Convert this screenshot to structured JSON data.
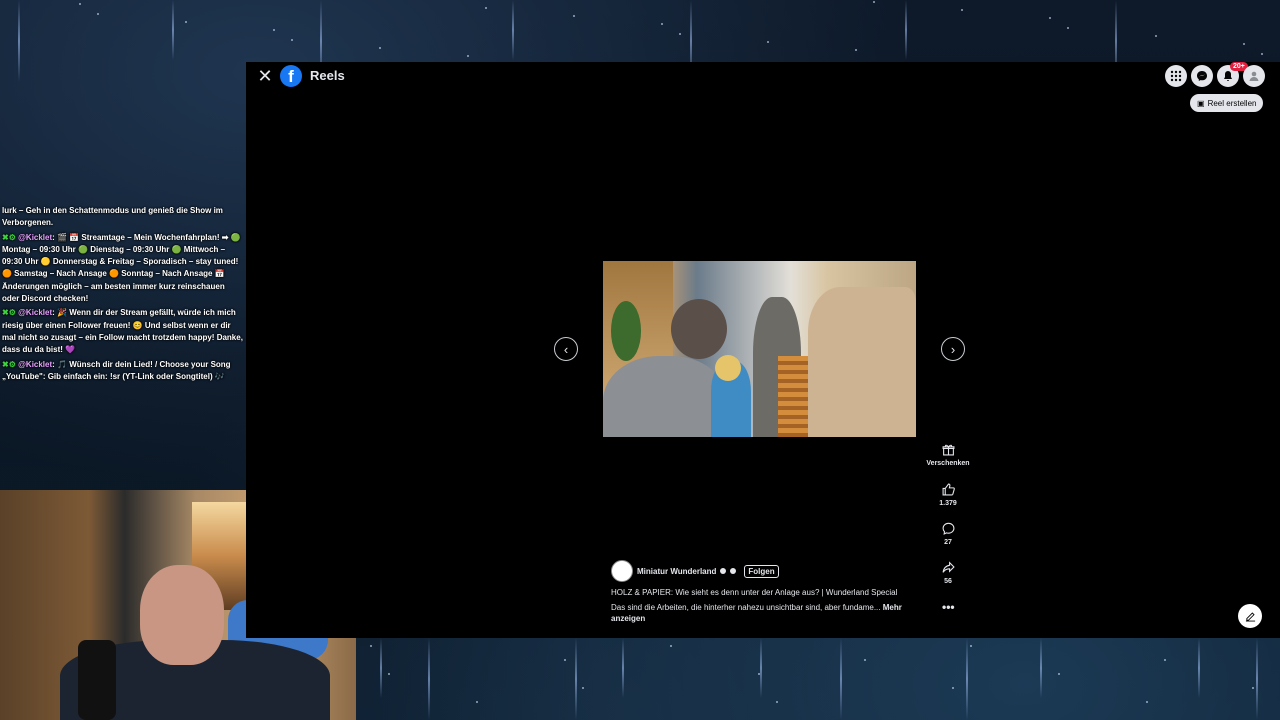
{
  "facebook": {
    "close_icon": "close-icon",
    "logo_letter": "f",
    "page_title": "Reels",
    "top_icons": [
      "menu-grid-icon",
      "messenger-icon",
      "notifications-icon",
      "profile-icon"
    ],
    "notification_badge": "20+",
    "create_reel_label": "Reel erstellen",
    "reel": {
      "prev_icon": "chevron-left-icon",
      "next_icon": "chevron-right-icon",
      "actions": [
        {
          "icon": "gift-icon",
          "label": "Verschenken"
        },
        {
          "icon": "like-icon",
          "label": "1.379"
        },
        {
          "icon": "comment-icon",
          "label": "27"
        },
        {
          "icon": "share-icon",
          "label": "56"
        }
      ],
      "author": "Miniatur Wunderland",
      "follow_label": "Folgen",
      "title": "HOLZ & PAPIER: Wie sieht es denn unter der Anlage aus? | Wunderland Special",
      "description": "Das sind die Arbeiten, die hinterher nahezu unsichtbar sind, aber fundame...",
      "more_label": "Mehr anzeigen",
      "more_dots": "•••"
    }
  },
  "chat": {
    "messages": [
      {
        "user": "",
        "text": "lurk – Geh in den Schattenmodus und genieß die Show im Verborgenen."
      },
      {
        "user": "@Kicklet",
        "text": ": 🎬 📅 Streamtage – Mein Wochenfahrplan! ➡ 🟢 Montag – 09:30 Uhr 🟢 Dienstag – 09:30 Uhr 🟢 Mittwoch – 09:30 Uhr 🟡 Donnerstag & Freitag – Sporadisch – stay tuned! 🟠 Samstag – Nach Ansage 🟠 Sonntag – Nach Ansage 📅 Änderungen möglich – am besten immer kurz reinschauen oder Discord checken!"
      },
      {
        "user": "@Kicklet",
        "text": ": 🎉 Wenn dir der Stream gefällt, würde ich mich riesig über einen Follower freuen! 😊 Und selbst wenn er dir mal nicht so zusagt – ein Follow macht trotzdem happy! Danke, dass du da bist! 💜"
      },
      {
        "user": "@Kicklet",
        "text": ": 🎵 Wünsch dir dein Lied! / Choose your Song „YouTube\": Gib einfach ein: !sr (YT-Link oder Songtitel) 🎶"
      }
    ],
    "tag_icon": "✖⚙"
  },
  "colors": {
    "facebook_blue": "#1877f2",
    "badge_red": "#e41e3f",
    "chat_user": "#e8a2ff"
  }
}
